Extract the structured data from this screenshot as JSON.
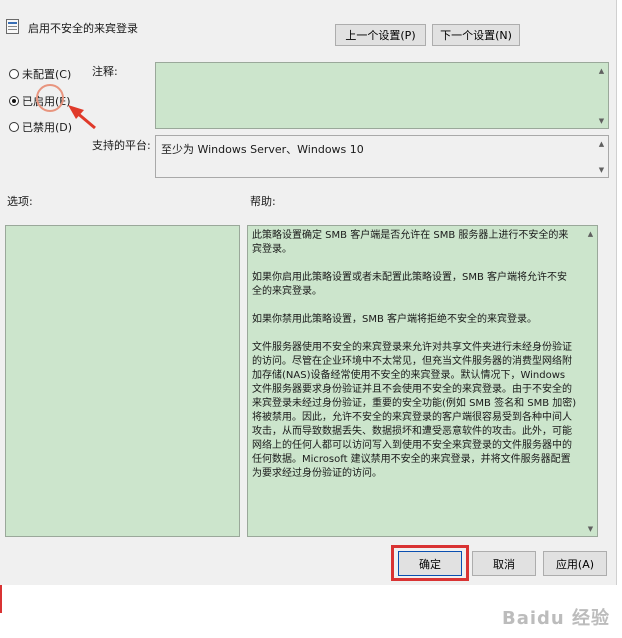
{
  "window": {
    "title": "启用不安全的来宾登录"
  },
  "nav": {
    "prev_label": "上一个设置(P)",
    "next_label": "下一个设置(N)"
  },
  "state": {
    "options": [
      {
        "label": "未配置(C)",
        "selected": false
      },
      {
        "label": "已启用(E)",
        "selected": true
      },
      {
        "label": "已禁用(D)",
        "selected": false
      }
    ]
  },
  "comment": {
    "label": "注释:",
    "value": ""
  },
  "platform": {
    "label": "支持的平台:",
    "value": "至少为 Windows Server、Windows 10"
  },
  "options_panel": {
    "label": "选项:"
  },
  "help": {
    "label": "帮助:",
    "text": "此策略设置确定 SMB 客户端是否允许在 SMB 服务器上进行不安全的来\n宾登录。\n\n如果你启用此策略设置或者未配置此策略设置，SMB 客户端将允许不安\n全的来宾登录。\n\n如果你禁用此策略设置，SMB 客户端将拒绝不安全的来宾登录。\n\n文件服务器使用不安全的来宾登录来允许对共享文件夹进行未经身份验证\n的访问。尽管在企业环境中不太常见，但充当文件服务器的消费型网络附\n加存储(NAS)设备经常使用不安全的来宾登录。默认情况下，Windows\n文件服务器要求身份验证并且不会使用不安全的来宾登录。由于不安全的\n来宾登录未经过身份验证，重要的安全功能(例如 SMB 签名和 SMB 加密)\n将被禁用。因此，允许不安全的来宾登录的客户端很容易受到各种中间人\n攻击，从而导致数据丢失、数据损坏和遭受恶意软件的攻击。此外，可能\n网络上的任何人都可以访问写入到使用不安全来宾登录的文件服务器中的\n任何数据。Microsoft 建议禁用不安全的来宾登录，并将文件服务器配置\n为要求经过身份验证的访问。"
  },
  "buttons": {
    "ok": "确定",
    "cancel": "取消",
    "apply": "应用(A)"
  },
  "watermark": "Baidu 经验",
  "colors": {
    "field_green": "#cce5cc",
    "highlight_red": "#d93333",
    "annotation_red": "#e03a2a"
  }
}
